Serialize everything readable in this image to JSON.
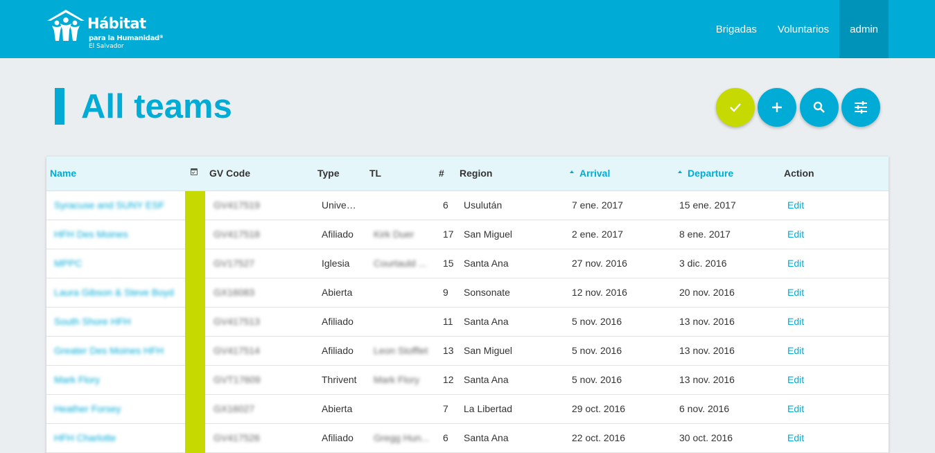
{
  "header": {
    "logo": {
      "name": "Hábitat",
      "subtitle": "para la Humanidad",
      "reg": "®",
      "country": "El Salvador"
    },
    "nav": [
      {
        "label": "Brigadas",
        "active": false
      },
      {
        "label": "Voluntarios",
        "active": false
      },
      {
        "label": "admin",
        "active": true
      }
    ]
  },
  "page": {
    "title": "All teams"
  },
  "actions": [
    {
      "name": "confirm",
      "icon": "check-icon",
      "color": "#c6d900"
    },
    {
      "name": "add",
      "icon": "plus-icon",
      "color": "#00acd6"
    },
    {
      "name": "search",
      "icon": "search-icon",
      "color": "#00acd6"
    },
    {
      "name": "filters",
      "icon": "sliders-icon",
      "color": "#00acd6"
    }
  ],
  "colors": {
    "accent": "#00acd6",
    "accent_dark": "#0093b9",
    "status": "#c6d900",
    "background": "#ebeef1",
    "table_header": "#e5f6fb"
  },
  "table": {
    "headers": {
      "name": "Name",
      "status_icon": "calendar-check-icon",
      "gv_code": "GV Code",
      "type": "Type",
      "tl": "TL",
      "count": "#",
      "region": "Region",
      "arrival": "Arrival",
      "departure": "Departure",
      "action": "Action"
    },
    "sorted_columns": [
      "arrival",
      "departure"
    ],
    "rows": [
      {
        "name": "Syracuse and SUNY ESF",
        "gv_code": "GV417519",
        "type": "Universidad",
        "tl": "",
        "count": "6",
        "region": "Usulután",
        "arrival": "7 ene. 2017",
        "departure": "15 ene. 2017",
        "action": "Edit"
      },
      {
        "name": "HFH Des Moines",
        "gv_code": "GV417518",
        "type": "Afiliado",
        "tl": "Kirk Duer",
        "count": "17",
        "region": "San Miguel",
        "arrival": "2 ene. 2017",
        "departure": "8 ene. 2017",
        "action": "Edit"
      },
      {
        "name": "MPPC",
        "gv_code": "GV17527",
        "type": "Iglesia",
        "tl": "Courtauld ...",
        "count": "15",
        "region": "Santa Ana",
        "arrival": "27 nov. 2016",
        "departure": "3 dic. 2016",
        "action": "Edit"
      },
      {
        "name": "Laura Gibson & Steve Boyd",
        "gv_code": "GX16083",
        "type": "Abierta",
        "tl": "",
        "count": "9",
        "region": "Sonsonate",
        "arrival": "12 nov. 2016",
        "departure": "20 nov. 2016",
        "action": "Edit"
      },
      {
        "name": "South Shore HFH",
        "gv_code": "GV417513",
        "type": "Afiliado",
        "tl": "",
        "count": "11",
        "region": "Santa Ana",
        "arrival": "5 nov. 2016",
        "departure": "13 nov. 2016",
        "action": "Edit"
      },
      {
        "name": "Greater Des Moines HFH",
        "gv_code": "GV417514",
        "type": "Afiliado",
        "tl": "Leon Stofflet",
        "count": "13",
        "region": "San Miguel",
        "arrival": "5 nov. 2016",
        "departure": "13 nov. 2016",
        "action": "Edit"
      },
      {
        "name": "Mark Flory",
        "gv_code": "GVT17609",
        "type": "Thrivent",
        "tl": "Mark Flory",
        "count": "12",
        "region": "Santa Ana",
        "arrival": "5 nov. 2016",
        "departure": "13 nov. 2016",
        "action": "Edit"
      },
      {
        "name": "Heather Forsey",
        "gv_code": "GX16027",
        "type": "Abierta",
        "tl": "",
        "count": "7",
        "region": "La Libertad",
        "arrival": "29 oct. 2016",
        "departure": "6 nov. 2016",
        "action": "Edit"
      },
      {
        "name": "HFH Charlotte",
        "gv_code": "GV417526",
        "type": "Afiliado",
        "tl": "Gregg Hun...",
        "count": "6",
        "region": "Santa Ana",
        "arrival": "22 oct. 2016",
        "departure": "30 oct. 2016",
        "action": "Edit"
      }
    ]
  }
}
